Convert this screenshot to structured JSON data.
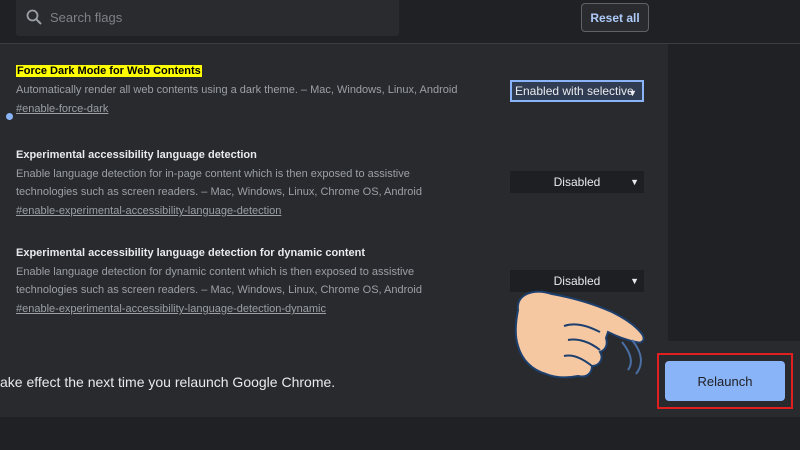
{
  "search": {
    "placeholder": "Search flags"
  },
  "toolbar": {
    "reset_label": "Reset all"
  },
  "flags": [
    {
      "title": "Force Dark Mode for Web Contents",
      "description": "Automatically render all web contents using a dark theme. – Mac, Windows, Linux, Android",
      "link": "#enable-force-dark",
      "value": "Enabled with selective"
    },
    {
      "title": "Experimental accessibility language detection",
      "description_line1": "Enable language detection for in-page content which is then exposed to assistive",
      "description_line2": "technologies such as screen readers. – Mac, Windows, Linux, Chrome OS, Android",
      "link": "#enable-experimental-accessibility-language-detection",
      "value": "Disabled"
    },
    {
      "title": "Experimental accessibility language detection for dynamic content",
      "description_line1": "Enable language detection for dynamic content which is then exposed to assistive",
      "description_line2": "technologies such as screen readers. – Mac, Windows, Linux, Chrome OS, Android",
      "link": "#enable-experimental-accessibility-language-detection-dynamic",
      "value": "Disabled"
    }
  ],
  "footer": {
    "message": "ake effect the next time you relaunch Google Chrome.",
    "relaunch_label": "Relaunch"
  },
  "colors": {
    "accent": "#8ab4f8",
    "highlight": "#ffff00",
    "callout": "#e02020"
  }
}
